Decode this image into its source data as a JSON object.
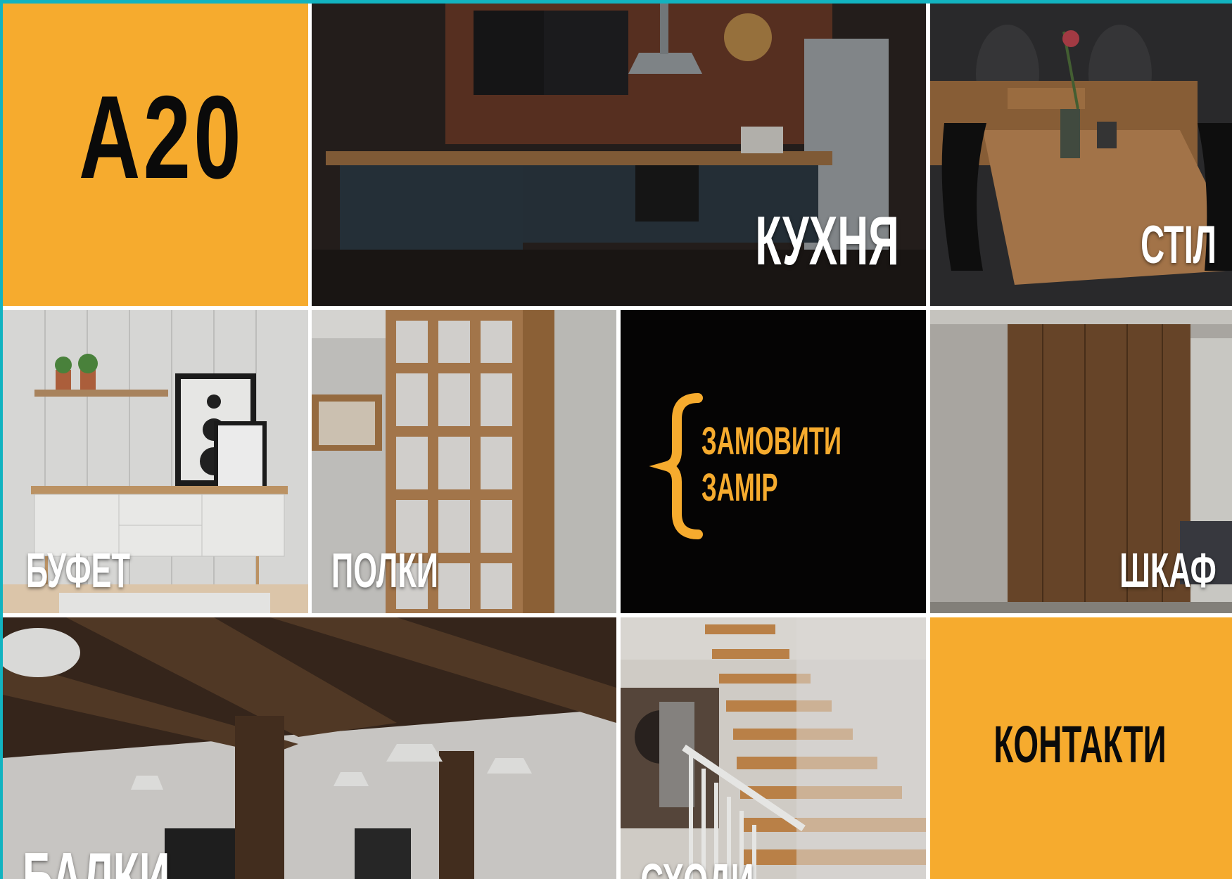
{
  "logo": {
    "text": "A20"
  },
  "tiles": {
    "kitchen": {
      "label": "КУХНЯ"
    },
    "table": {
      "label": "СТІЛ"
    },
    "buffet": {
      "label": "БУФЕТ"
    },
    "shelves": {
      "label": "ПОЛКИ"
    },
    "order": {
      "line1": "ЗАМОВИТИ",
      "line2": "ЗАМІР"
    },
    "wardrobe": {
      "label": "ШКАФ"
    },
    "beams": {
      "label": "БАЛКИ"
    },
    "stairs": {
      "label": "СХОДИ"
    },
    "contacts": {
      "label": "КОНТАКТИ"
    }
  },
  "colors": {
    "accent_orange": "#f6ab2e",
    "frame_teal": "#12b3c0",
    "order_bg": "#050404"
  }
}
